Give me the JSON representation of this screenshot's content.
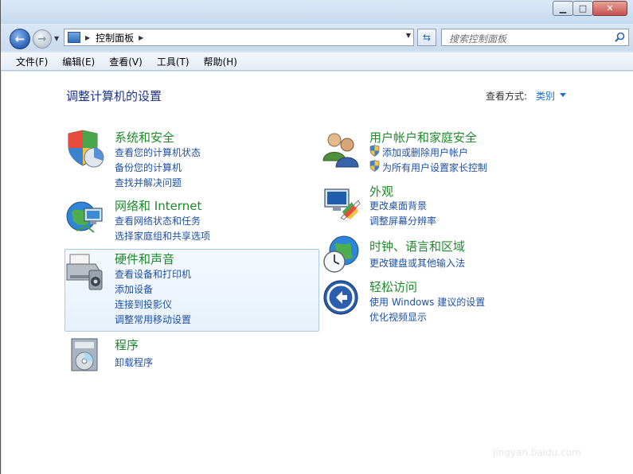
{
  "nav": {
    "breadcrumb": "控制面板",
    "search_placeholder": "搜索控制面板"
  },
  "menu": [
    "文件(F)",
    "编辑(E)",
    "查看(V)",
    "工具(T)",
    "帮助(H)"
  ],
  "page": {
    "title": "调整计算机的设置",
    "view_by_label": "查看方式:",
    "view_by_value": "类别"
  },
  "categories": {
    "system": {
      "title": "系统和安全",
      "links": [
        "查看您的计算机状态",
        "备份您的计算机",
        "查找并解决问题"
      ]
    },
    "network": {
      "title": "网络和 Internet",
      "links": [
        "查看网络状态和任务",
        "选择家庭组和共享选项"
      ]
    },
    "hardware": {
      "title": "硬件和声音",
      "links": [
        "查看设备和打印机",
        "添加设备",
        "连接到投影仪",
        "调整常用移动设置"
      ]
    },
    "programs": {
      "title": "程序",
      "links": [
        "卸载程序"
      ]
    },
    "users": {
      "title": "用户帐户和家庭安全",
      "links": [
        "添加或删除用户帐户",
        "为所有用户设置家长控制"
      ]
    },
    "appearance": {
      "title": "外观",
      "links": [
        "更改桌面背景",
        "调整屏幕分辨率"
      ]
    },
    "clock": {
      "title": "时钟、语言和区域",
      "links": [
        "更改键盘或其他输入法"
      ]
    },
    "ease": {
      "title": "轻松访问",
      "links": [
        "使用 Windows 建议的设置",
        "优化视频显示"
      ]
    }
  },
  "watermark": "jingyan.baidu.com"
}
